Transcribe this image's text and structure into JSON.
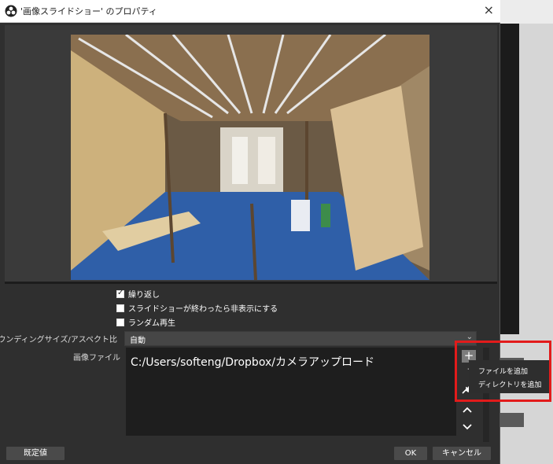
{
  "window": {
    "title": "'画像スライドショー' のプロパティ",
    "close_label": "×"
  },
  "options": {
    "loop_label": "繰り返し",
    "loop_checked": true,
    "hide_when_done_label": "スライドショーが終わったら非表示にする",
    "hide_when_done_checked": false,
    "random_label": "ランダム再生",
    "random_checked": false
  },
  "bounding": {
    "label": "バウンディングサイズ/アスペクト比",
    "value": "自動"
  },
  "files": {
    "label": "画像ファイル",
    "items": [
      "C:/Users/softeng/Dropbox/カメラアップロード"
    ]
  },
  "add_menu": {
    "add_files": "ファイルを追加",
    "add_directory": "ディレクトリを追加"
  },
  "buttons": {
    "defaults": "既定値",
    "ok": "OK",
    "cancel": "キャンセル"
  },
  "icons": {
    "app": "obs-logo-icon",
    "add": "plus-icon",
    "up": "chevron-up-icon",
    "down": "chevron-down-icon",
    "settings": "wrench-icon"
  },
  "colors": {
    "dialog_bg": "#2f2f2f",
    "highlight": "#e21b1b"
  }
}
